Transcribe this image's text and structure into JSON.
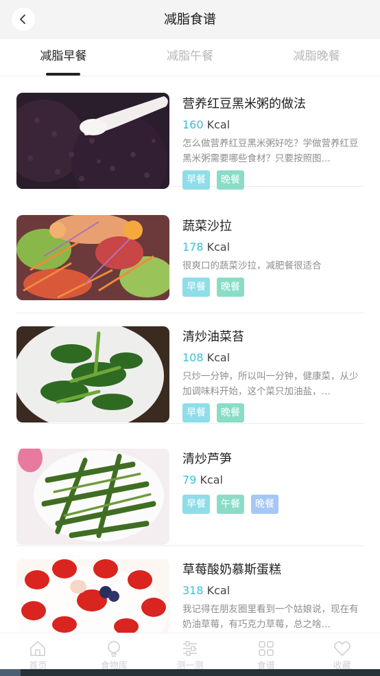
{
  "header": {
    "title": "减脂食谱",
    "back_icon": "chevron-left-icon"
  },
  "tabs": [
    {
      "label": "减脂早餐",
      "active": true
    },
    {
      "label": "减脂午餐",
      "active": false
    },
    {
      "label": "减脂晚餐",
      "active": false
    }
  ],
  "colors": {
    "kcal": "#37c1d6",
    "tag_breakfast": "#8fdde9",
    "tag_lunch": "#8bdcc7",
    "tag_dinner": "#a6c7f4"
  },
  "recipes": [
    {
      "name": "营养红豆黑米粥的做法",
      "kcal_value": "160",
      "kcal_unit": "Kcal",
      "description": "怎么做营养红豆黑米粥好吃？学做营养红豆黑米粥需要哪些食材？只要按照图…",
      "tags": [
        "早餐",
        "晚餐"
      ]
    },
    {
      "name": "蔬菜沙拉",
      "kcal_value": "178",
      "kcal_unit": "Kcal",
      "description": "很爽口的蔬菜沙拉，减肥餐很适合",
      "tags": [
        "早餐",
        "晚餐"
      ]
    },
    {
      "name": "清炒油菜苔",
      "kcal_value": "108",
      "kcal_unit": "Kcal",
      "description": "只炒一分钟，所以叫一分钟，健康菜，从少加调味料开始，这个菜只加油盐，…",
      "tags": [
        "早餐",
        "晚餐"
      ]
    },
    {
      "name": "清炒芦笋",
      "kcal_value": "79",
      "kcal_unit": "Kcal",
      "description": "",
      "tags": [
        "早餐",
        "午餐",
        "晚餐"
      ]
    },
    {
      "name": "草莓酸奶慕斯蛋糕",
      "kcal_value": "318",
      "kcal_unit": "Kcal",
      "description": "我记得在朋友圈里看到一个姑娘说，现在有奶油草莓，有巧克力草莓，总之啥…",
      "tags": []
    }
  ],
  "bottom_nav": [
    {
      "label": "首页",
      "icon": "home-icon"
    },
    {
      "label": "食物库",
      "icon": "lightbulb-icon"
    },
    {
      "label": "测一测",
      "icon": "sliders-icon"
    },
    {
      "label": "食谱",
      "icon": "grid-icon"
    },
    {
      "label": "收藏",
      "icon": "heart-icon"
    }
  ]
}
